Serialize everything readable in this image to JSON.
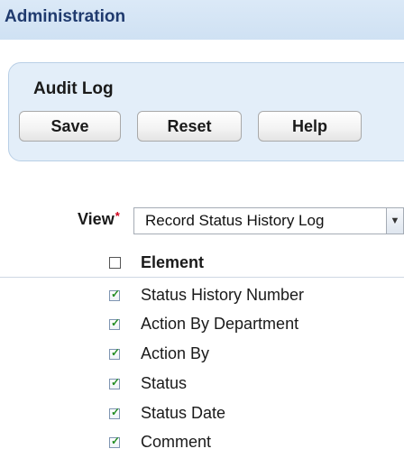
{
  "header": {
    "title": "Administration"
  },
  "panel": {
    "title": "Audit Log",
    "buttons": {
      "save": "Save",
      "reset": "Reset",
      "help": "Help"
    }
  },
  "view": {
    "label": "View",
    "required_marker": "*",
    "selected": "Record Status History Log"
  },
  "list": {
    "header": "Element",
    "items": [
      {
        "label": "Status History Number",
        "checked": true
      },
      {
        "label": "Action By Department",
        "checked": true
      },
      {
        "label": "Action By",
        "checked": true
      },
      {
        "label": "Status",
        "checked": true
      },
      {
        "label": "Status Date",
        "checked": true
      },
      {
        "label": "Comment",
        "checked": true
      }
    ]
  },
  "icons": {
    "checkbox_checked": "check-icon",
    "dropdown_arrow": "chevron-down-icon"
  },
  "colors": {
    "header_bg": "#d6e6f6",
    "header_text": "#1f3a6e",
    "panel_bg": "#e3eef9",
    "required": "#d0021b",
    "check": "#218c21"
  }
}
